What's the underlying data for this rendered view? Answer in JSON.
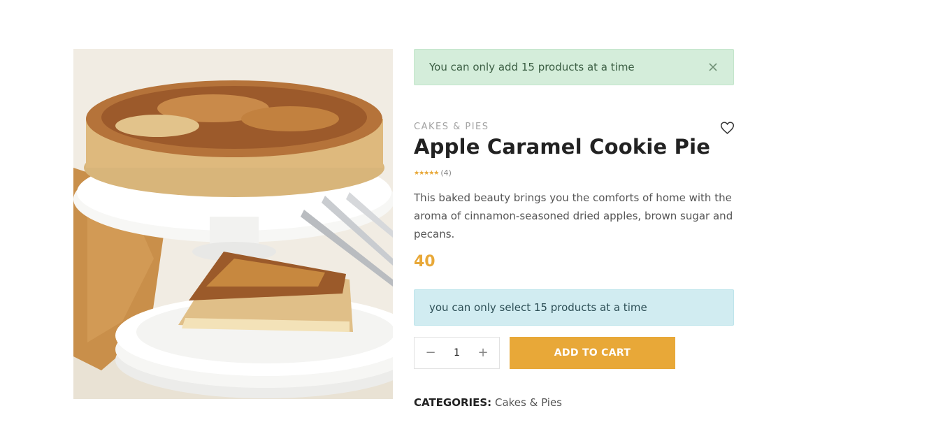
{
  "alerts": {
    "success_message": "You can only add 15 products at a time",
    "info_message": "you can only select 15 products at a time"
  },
  "product": {
    "category": "CAKES & PIES",
    "title": "Apple Caramel Cookie Pie",
    "rating_stars": "★★★★★",
    "rating_count": "(4)",
    "description": "This baked beauty brings you the comforts of home with the aroma of cinnamon-seasoned dried apples, brown sugar and pecans.",
    "price": "40"
  },
  "cart": {
    "quantity": "1",
    "minus_symbol": "−",
    "plus_symbol": "+",
    "add_to_cart_label": "ADD TO CART"
  },
  "meta": {
    "categories_label": "CATEGORIES:",
    "categories_value": "Cakes & Pies"
  },
  "colors": {
    "accent": "#e8a838",
    "success_bg": "#d4edda",
    "info_bg": "#d1ecf1"
  },
  "icons": {
    "close": "close-icon",
    "wishlist": "heart-icon"
  }
}
